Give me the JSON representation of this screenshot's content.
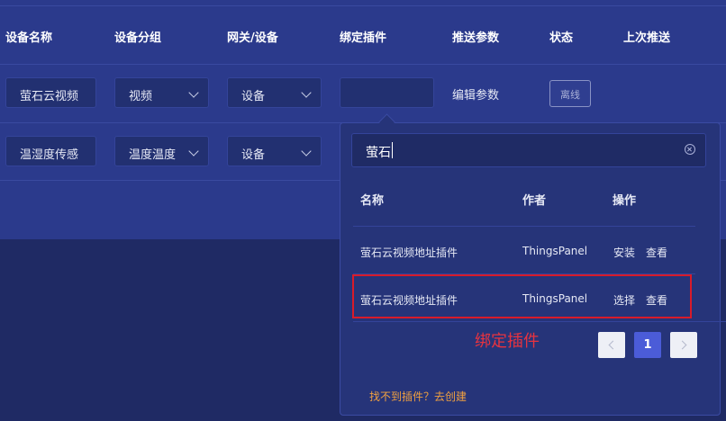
{
  "table": {
    "columns": [
      "设备名称",
      "设备分组",
      "网关/设备",
      "绑定插件",
      "推送参数",
      "状态",
      "上次推送"
    ],
    "rows": [
      {
        "name": "萤石云视频",
        "group": "视频",
        "gateway": "设备",
        "plugin": "",
        "push": "编辑参数",
        "status": "离线"
      },
      {
        "name": "温湿度传感",
        "group": "温度温度",
        "gateway": "设备",
        "plugin": "",
        "push": "",
        "status": ""
      }
    ]
  },
  "popup": {
    "search_value": "萤石",
    "columns": [
      "名称",
      "作者",
      "操作"
    ],
    "items": [
      {
        "name": "萤石云视频地址插件",
        "author": "ThingsPanel",
        "action": "安装",
        "view": "查看"
      },
      {
        "name": "萤石云视频地址插件",
        "author": "ThingsPanel",
        "action": "选择",
        "view": "查看"
      }
    ],
    "page": "1",
    "footer_link": "找不到插件？去创建"
  },
  "annotation": "绑定插件",
  "colors": {
    "accent": "#4b5cd8",
    "highlight": "#d81b2a",
    "link": "#f0a040"
  }
}
